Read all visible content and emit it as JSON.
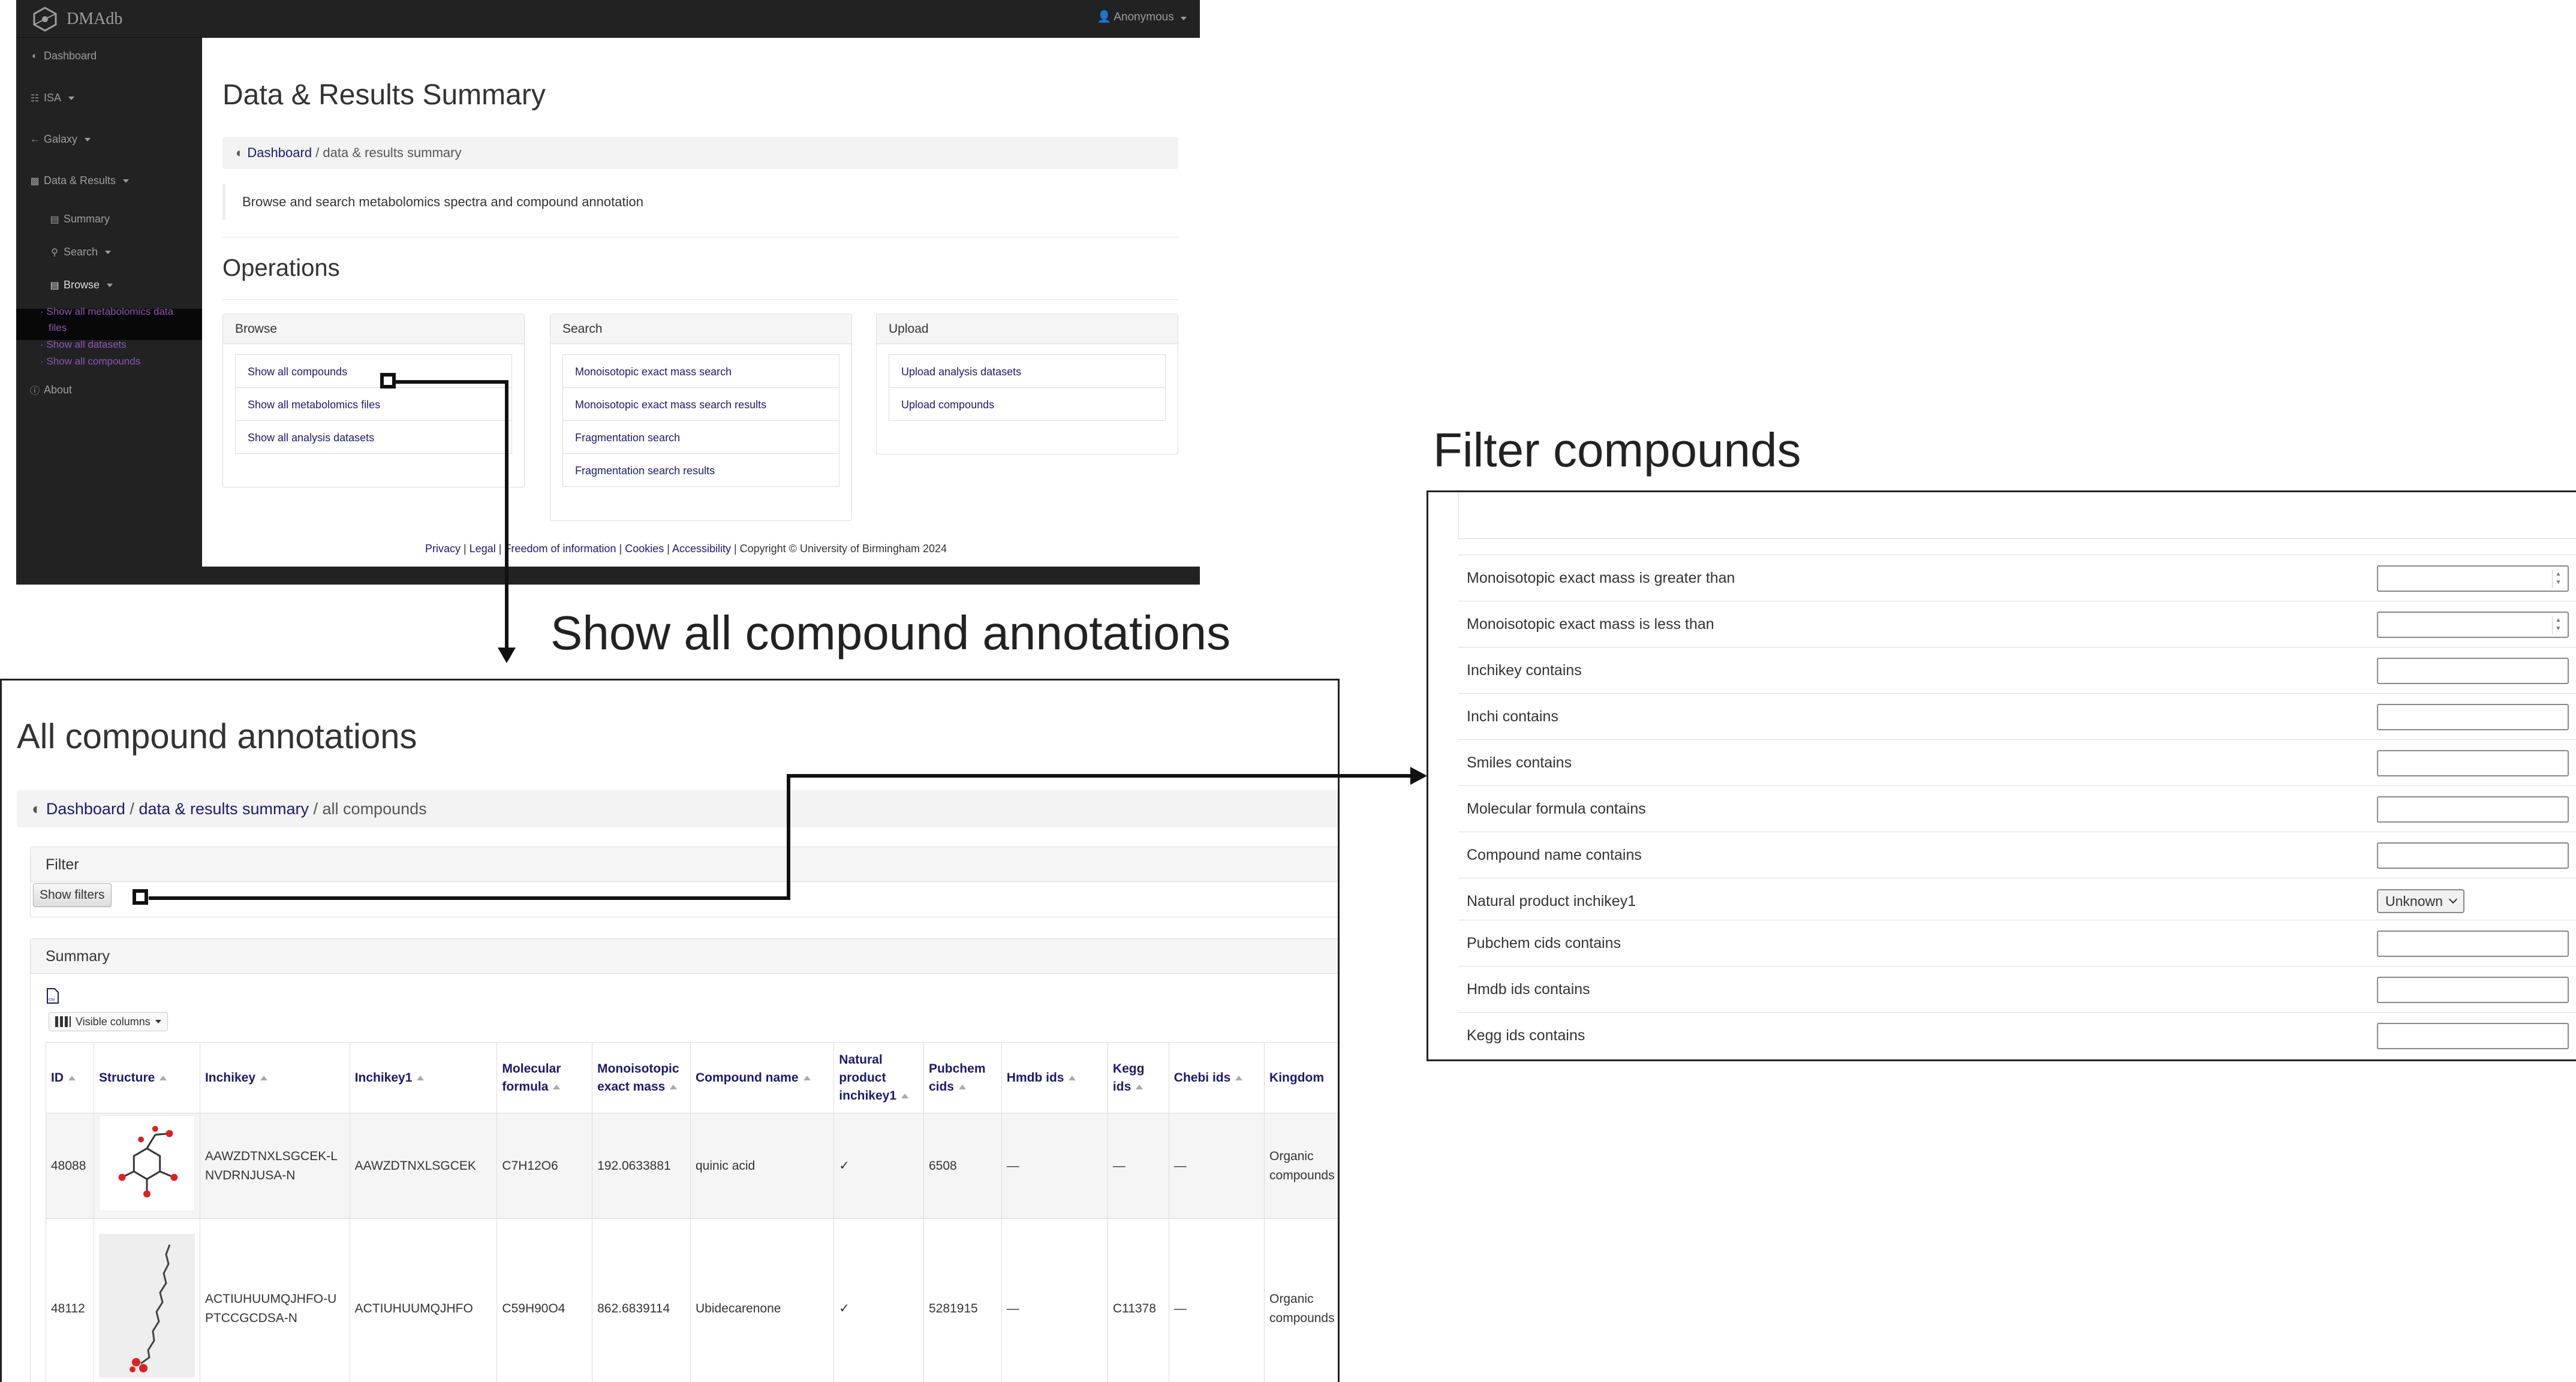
{
  "dashboard": {
    "brand": "DMAdb",
    "user_menu": "Anonymous",
    "sidebar": {
      "dashboard": "Dashboard",
      "isa": "ISA",
      "galaxy": "Galaxy",
      "data_results": "Data & Results",
      "summary": "Summary",
      "search": "Search",
      "browse": "Browse",
      "browse_links": [
        "Show all metabolomics data",
        "files",
        "Show all datasets",
        "Show all compounds"
      ],
      "about": "About"
    },
    "title": "Data & Results Summary",
    "breadcrumb": {
      "home": "Dashboard",
      "current": "/ data & results summary"
    },
    "description": "Browse and search metabolomics spectra and compound annotation",
    "operations_heading": "Operations",
    "cards": {
      "browse": {
        "title": "Browse",
        "items": [
          "Show all compounds",
          "Show all metabolomics files",
          "Show all analysis datasets"
        ]
      },
      "search": {
        "title": "Search",
        "items": [
          "Monoisotopic exact mass search",
          "Monoisotopic exact mass search results",
          "Fragmentation search",
          "Fragmentation search results"
        ]
      },
      "upload": {
        "title": "Upload",
        "items": [
          "Upload analysis datasets",
          "Upload compounds"
        ]
      }
    },
    "footer": {
      "links": [
        "Privacy",
        "Legal",
        "Freedom of information",
        "Cookies",
        "Accessibility"
      ],
      "separator": " | ",
      "copyright": " | Copyright © University of Birmingham 2024"
    }
  },
  "captions": {
    "show_all": "Show all compound annotations",
    "filter": "Filter compounds"
  },
  "compounds_page": {
    "title": "All compound annotations",
    "breadcrumb": {
      "home": "Dashboard",
      "summary": "data & results summary",
      "sep1": " / ",
      "sep2": " / all compounds"
    },
    "filter_header": "Filter",
    "show_filters_button": "Show filters",
    "summary_header": "Summary",
    "visible_columns": "Visible columns",
    "columns": [
      "ID",
      "Structure",
      "Inchikey",
      "Inchikey1",
      "Molecular formula",
      "Monoisotopic exact mass",
      "Compound name",
      "Natural product inchikey1",
      "Pubchem cids",
      "Hmdb ids",
      "Kegg ids",
      "Chebi ids",
      "Kingdom"
    ],
    "rows": [
      {
        "id": "48088",
        "inchikey": "AAWZDTNXLSGCEK-LNVDRNJUSA-N",
        "inchikey1": "AAWZDTNXLSGCEK",
        "formula": "C7H12O6",
        "mass": "192.0633881",
        "name": "quinic acid",
        "natural": "✓",
        "pubchem": "6508",
        "hmdb": "—",
        "kegg": "—",
        "chebi": "—",
        "kingdom": "Organic compounds"
      },
      {
        "id": "48112",
        "inchikey": "ACTIUHUUMQJHFO-UPTCCGCDSA-N",
        "inchikey1": "ACTIUHUUMQJHFO",
        "formula": "C59H90O4",
        "mass": "862.6839114",
        "name": "Ubidecarenone",
        "natural": "✓",
        "pubchem": "5281915",
        "hmdb": "—",
        "kegg": "C11378",
        "chebi": "—",
        "kingdom": "Organic compounds"
      }
    ]
  },
  "filter_panel": {
    "rows": [
      {
        "label": "Monoisotopic exact mass is greater than",
        "type": "number",
        "value": ""
      },
      {
        "label": "Monoisotopic exact mass is less than",
        "type": "number",
        "value": ""
      },
      {
        "label": "Inchikey contains",
        "type": "text",
        "value": ""
      },
      {
        "label": "Inchi contains",
        "type": "text",
        "value": ""
      },
      {
        "label": "Smiles contains",
        "type": "text",
        "value": ""
      },
      {
        "label": "Molecular formula contains",
        "type": "text",
        "value": ""
      },
      {
        "label": "Compound name contains",
        "type": "text",
        "value": ""
      },
      {
        "label": "Natural product inchikey1",
        "type": "select",
        "value": "Unknown"
      },
      {
        "label": "Pubchem cids contains",
        "type": "text",
        "value": ""
      },
      {
        "label": "Hmdb ids contains",
        "type": "text",
        "value": ""
      },
      {
        "label": "Kegg ids contains",
        "type": "text",
        "value": ""
      }
    ]
  }
}
